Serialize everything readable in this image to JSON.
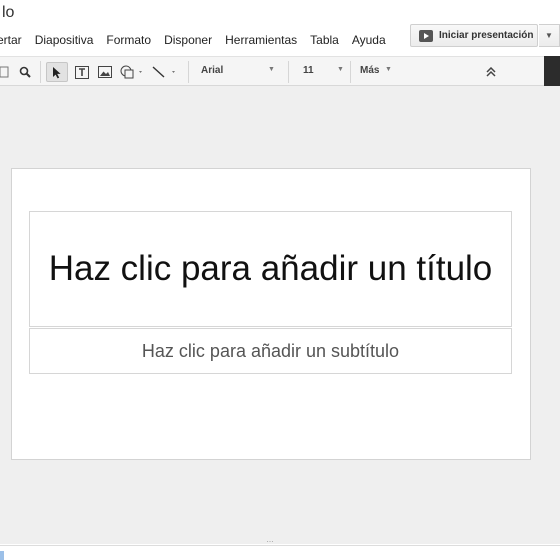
{
  "document": {
    "title_fragment": "lo"
  },
  "menubar": {
    "items": [
      "ertar",
      "Diapositiva",
      "Formato",
      "Disponer",
      "Herramientas",
      "Tabla",
      "Ayuda"
    ]
  },
  "present_button": {
    "label": "Iniciar presentación",
    "icon": "play-icon"
  },
  "toolbar": {
    "font": "Arial",
    "font_size": "11",
    "more": "Más",
    "tools": [
      "zoom-icon",
      "select-arrow-icon",
      "text-box-icon",
      "image-icon",
      "shapes-icon",
      "line-icon",
      "collapse-icon"
    ]
  },
  "slide": {
    "title_placeholder": "Haz clic para añadir un título",
    "subtitle_placeholder": "Haz clic para añadir un subtítulo"
  }
}
